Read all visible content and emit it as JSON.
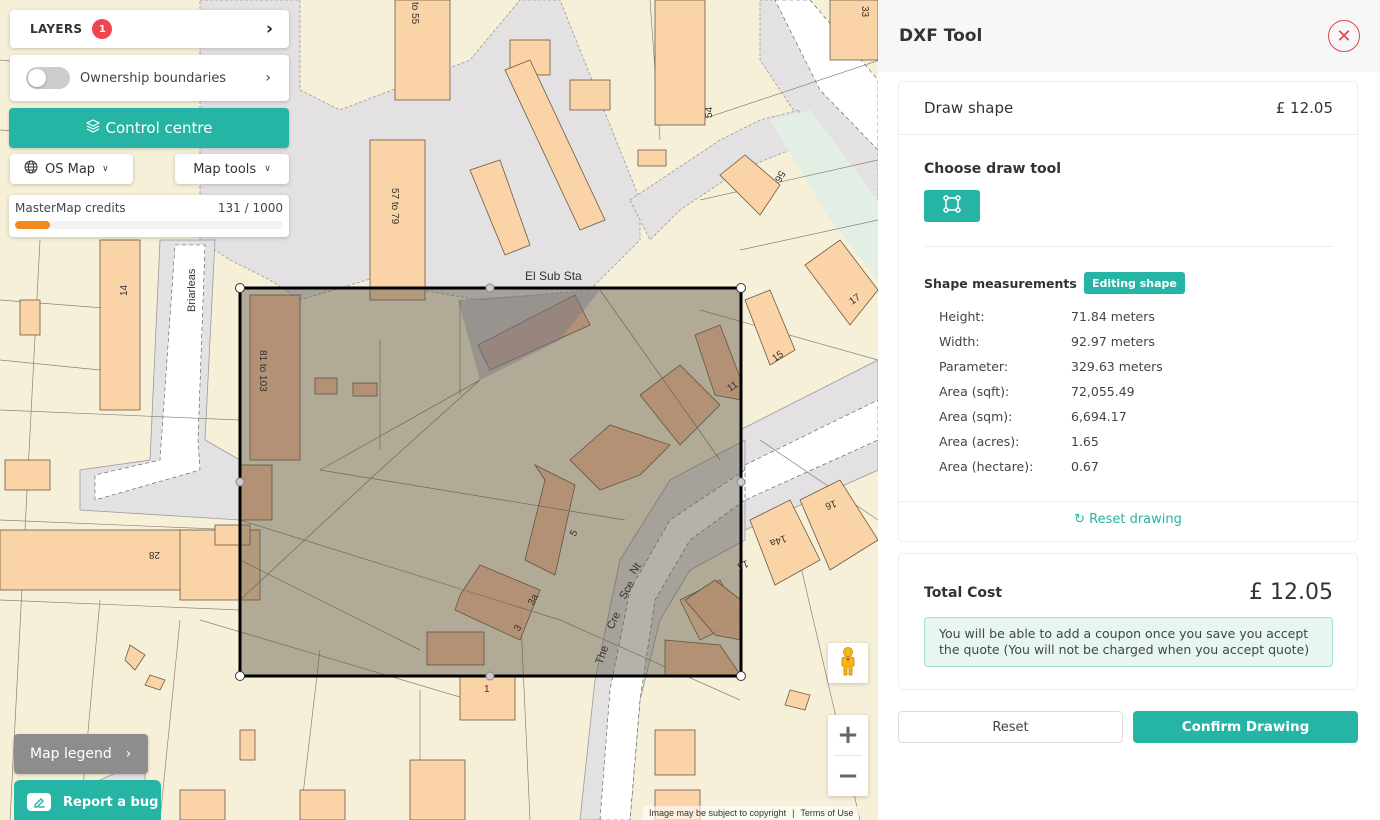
{
  "map": {
    "layers": {
      "label": "LAYERS",
      "badge_count": "1"
    },
    "ownership_boundaries": {
      "label": "Ownership boundaries",
      "enabled": false
    },
    "control_centre_label": "Control centre",
    "basemap_select": {
      "label": "OS Map"
    },
    "map_tools_label": "Map tools",
    "credits": {
      "label": "MasterMap credits",
      "used": 131,
      "total": 1000,
      "text": "131 / 1000",
      "bar_color": "#f5891f"
    },
    "legend_label": "Map legend",
    "report_bug_label": "Report a bug",
    "attribution": {
      "copyright": "Image may be subject to copyright",
      "terms": "Terms of Use"
    },
    "labels": {
      "substation": "El Sub Sta",
      "road_briarleas": "Briarleas",
      "road_crescent": [
        "The",
        "Cre",
        "Sce",
        "Nt"
      ],
      "houses": [
        "to 55",
        "57 to 79",
        "81 to 103",
        "54",
        "33",
        "56",
        "17",
        "15",
        "11",
        "14",
        "28",
        "5",
        "3a",
        "3",
        "1",
        "16",
        "14a",
        "14"
      ]
    }
  },
  "panel": {
    "title": "DXF Tool",
    "draw_shape": {
      "label": "Draw shape",
      "price": "£ 12.05"
    },
    "choose_tool_title": "Choose draw tool",
    "measurements_title": "Shape measurements",
    "editing_badge": "Editing shape",
    "measurements": [
      {
        "label": "Height:",
        "value": "71.84 meters"
      },
      {
        "label": "Width:",
        "value": "92.97 meters"
      },
      {
        "label": "Parameter:",
        "value": "329.63 meters"
      },
      {
        "label": "Area (sqft):",
        "value": "72,055.49"
      },
      {
        "label": "Area (sqm):",
        "value": "6,694.17"
      },
      {
        "label": "Area (acres):",
        "value": "1.65"
      },
      {
        "label": "Area (hectare):",
        "value": "0.67"
      }
    ],
    "reset_drawing_label": "Reset drawing",
    "total_cost": {
      "label": "Total Cost",
      "value": "£ 12.05"
    },
    "coupon_note": "You will be able to add a coupon once you save you accept the quote (You will not be charged when you accept quote)",
    "reset_label": "Reset",
    "confirm_label": "Confirm Drawing"
  },
  "colors": {
    "accent": "#26b5a5",
    "danger": "#e0464f",
    "badge": "#ef4550"
  }
}
